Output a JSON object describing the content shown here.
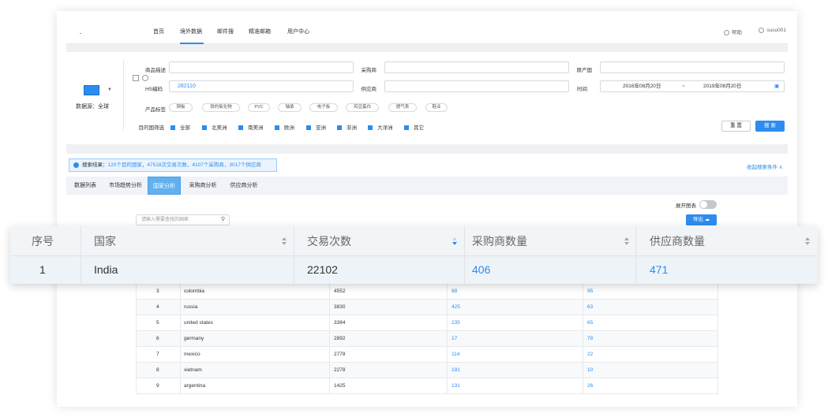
{
  "nav": {
    "items": [
      "首页",
      "境外数据",
      "邮件搜",
      "精准邮箱",
      "用户中心"
    ],
    "help": "帮助",
    "user": "susu001"
  },
  "search": {
    "source_label": "数据源：全球",
    "fields": {
      "product_desc_label": "商品描述",
      "buyer_label": "采购商",
      "origin_label": "原产国",
      "hs_label": "HS编码",
      "hs_value": "282110",
      "supplier_label": "供应商",
      "time_label": "时间",
      "date_from": "2016年08月20日",
      "date_sep": "~",
      "date_to": "2019年08月20日"
    },
    "tags_label": "产品标签",
    "tags": [
      "铜板",
      "铁的氧化物",
      "PVC",
      "轴承",
      "电子板",
      "鸡豆蛋白",
      "燃气表",
      "鞋业"
    ],
    "dest_label": "目的国筛选",
    "regions": [
      "全部",
      "北美洲",
      "南美洲",
      "欧洲",
      "亚洲",
      "非洲",
      "大洋洲",
      "其它"
    ],
    "reset_button": "重 置",
    "search_button": "搜 索"
  },
  "summary": {
    "prefix": "搜索结果：",
    "text": "120个目的国家，47518次交易次数，4107个采购商，3017个供应商",
    "collapse": "收起搜索条件 ∧"
  },
  "tabs": [
    "数据列表",
    "市场趋势分析",
    "国家分析",
    "采购商分析",
    "供应商分析"
  ],
  "active_tab": 2,
  "controls": {
    "expand_chart": "展开图表",
    "country_search_placeholder": "请输入需要查找的国家",
    "export_button": "导出"
  },
  "table": {
    "columns": [
      "序号",
      "国家",
      "交易次数",
      "采购商数量",
      "供应商数量"
    ],
    "rows": [
      {
        "no": "1",
        "country": "India",
        "trades": "22102",
        "buyers": "406",
        "suppliers": "471"
      },
      {
        "no": "3",
        "country": "colombia",
        "trades": "4552",
        "buyers": "88",
        "suppliers": "95"
      },
      {
        "no": "4",
        "country": "russia",
        "trades": "3830",
        "buyers": "425",
        "suppliers": "63"
      },
      {
        "no": "5",
        "country": "united states",
        "trades": "3384",
        "buyers": "235",
        "suppliers": "65"
      },
      {
        "no": "6",
        "country": "germany",
        "trades": "2892",
        "buyers": "17",
        "suppliers": "78"
      },
      {
        "no": "7",
        "country": "mexico",
        "trades": "2778",
        "buyers": "114",
        "suppliers": "22"
      },
      {
        "no": "8",
        "country": "vietnam",
        "trades": "2278",
        "buyers": "191",
        "suppliers": "10"
      },
      {
        "no": "9",
        "country": "argentina",
        "trades": "1425",
        "buyers": "131",
        "suppliers": "26"
      }
    ]
  }
}
